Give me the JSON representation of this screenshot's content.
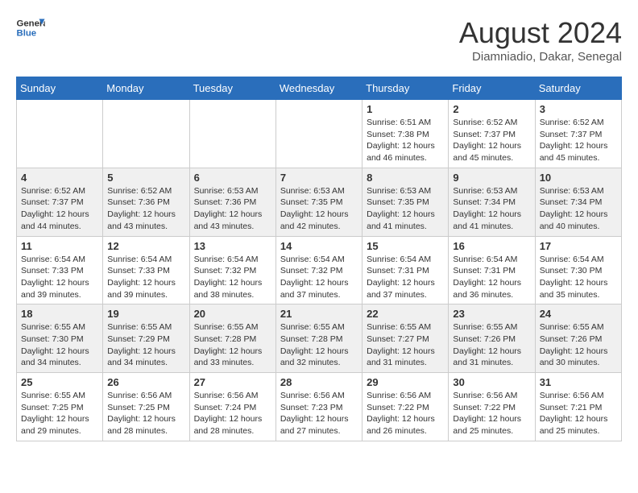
{
  "header": {
    "logo_line1": "General",
    "logo_line2": "Blue",
    "month_year": "August 2024",
    "location": "Diamniadio, Dakar, Senegal"
  },
  "days_of_week": [
    "Sunday",
    "Monday",
    "Tuesday",
    "Wednesday",
    "Thursday",
    "Friday",
    "Saturday"
  ],
  "weeks": [
    [
      {
        "day": "",
        "info": ""
      },
      {
        "day": "",
        "info": ""
      },
      {
        "day": "",
        "info": ""
      },
      {
        "day": "",
        "info": ""
      },
      {
        "day": "1",
        "info": "Sunrise: 6:51 AM\nSunset: 7:38 PM\nDaylight: 12 hours\nand 46 minutes."
      },
      {
        "day": "2",
        "info": "Sunrise: 6:52 AM\nSunset: 7:37 PM\nDaylight: 12 hours\nand 45 minutes."
      },
      {
        "day": "3",
        "info": "Sunrise: 6:52 AM\nSunset: 7:37 PM\nDaylight: 12 hours\nand 45 minutes."
      }
    ],
    [
      {
        "day": "4",
        "info": "Sunrise: 6:52 AM\nSunset: 7:37 PM\nDaylight: 12 hours\nand 44 minutes."
      },
      {
        "day": "5",
        "info": "Sunrise: 6:52 AM\nSunset: 7:36 PM\nDaylight: 12 hours\nand 43 minutes."
      },
      {
        "day": "6",
        "info": "Sunrise: 6:53 AM\nSunset: 7:36 PM\nDaylight: 12 hours\nand 43 minutes."
      },
      {
        "day": "7",
        "info": "Sunrise: 6:53 AM\nSunset: 7:35 PM\nDaylight: 12 hours\nand 42 minutes."
      },
      {
        "day": "8",
        "info": "Sunrise: 6:53 AM\nSunset: 7:35 PM\nDaylight: 12 hours\nand 41 minutes."
      },
      {
        "day": "9",
        "info": "Sunrise: 6:53 AM\nSunset: 7:34 PM\nDaylight: 12 hours\nand 41 minutes."
      },
      {
        "day": "10",
        "info": "Sunrise: 6:53 AM\nSunset: 7:34 PM\nDaylight: 12 hours\nand 40 minutes."
      }
    ],
    [
      {
        "day": "11",
        "info": "Sunrise: 6:54 AM\nSunset: 7:33 PM\nDaylight: 12 hours\nand 39 minutes."
      },
      {
        "day": "12",
        "info": "Sunrise: 6:54 AM\nSunset: 7:33 PM\nDaylight: 12 hours\nand 39 minutes."
      },
      {
        "day": "13",
        "info": "Sunrise: 6:54 AM\nSunset: 7:32 PM\nDaylight: 12 hours\nand 38 minutes."
      },
      {
        "day": "14",
        "info": "Sunrise: 6:54 AM\nSunset: 7:32 PM\nDaylight: 12 hours\nand 37 minutes."
      },
      {
        "day": "15",
        "info": "Sunrise: 6:54 AM\nSunset: 7:31 PM\nDaylight: 12 hours\nand 37 minutes."
      },
      {
        "day": "16",
        "info": "Sunrise: 6:54 AM\nSunset: 7:31 PM\nDaylight: 12 hours\nand 36 minutes."
      },
      {
        "day": "17",
        "info": "Sunrise: 6:54 AM\nSunset: 7:30 PM\nDaylight: 12 hours\nand 35 minutes."
      }
    ],
    [
      {
        "day": "18",
        "info": "Sunrise: 6:55 AM\nSunset: 7:30 PM\nDaylight: 12 hours\nand 34 minutes."
      },
      {
        "day": "19",
        "info": "Sunrise: 6:55 AM\nSunset: 7:29 PM\nDaylight: 12 hours\nand 34 minutes."
      },
      {
        "day": "20",
        "info": "Sunrise: 6:55 AM\nSunset: 7:28 PM\nDaylight: 12 hours\nand 33 minutes."
      },
      {
        "day": "21",
        "info": "Sunrise: 6:55 AM\nSunset: 7:28 PM\nDaylight: 12 hours\nand 32 minutes."
      },
      {
        "day": "22",
        "info": "Sunrise: 6:55 AM\nSunset: 7:27 PM\nDaylight: 12 hours\nand 31 minutes."
      },
      {
        "day": "23",
        "info": "Sunrise: 6:55 AM\nSunset: 7:26 PM\nDaylight: 12 hours\nand 31 minutes."
      },
      {
        "day": "24",
        "info": "Sunrise: 6:55 AM\nSunset: 7:26 PM\nDaylight: 12 hours\nand 30 minutes."
      }
    ],
    [
      {
        "day": "25",
        "info": "Sunrise: 6:55 AM\nSunset: 7:25 PM\nDaylight: 12 hours\nand 29 minutes."
      },
      {
        "day": "26",
        "info": "Sunrise: 6:56 AM\nSunset: 7:25 PM\nDaylight: 12 hours\nand 28 minutes."
      },
      {
        "day": "27",
        "info": "Sunrise: 6:56 AM\nSunset: 7:24 PM\nDaylight: 12 hours\nand 28 minutes."
      },
      {
        "day": "28",
        "info": "Sunrise: 6:56 AM\nSunset: 7:23 PM\nDaylight: 12 hours\nand 27 minutes."
      },
      {
        "day": "29",
        "info": "Sunrise: 6:56 AM\nSunset: 7:22 PM\nDaylight: 12 hours\nand 26 minutes."
      },
      {
        "day": "30",
        "info": "Sunrise: 6:56 AM\nSunset: 7:22 PM\nDaylight: 12 hours\nand 25 minutes."
      },
      {
        "day": "31",
        "info": "Sunrise: 6:56 AM\nSunset: 7:21 PM\nDaylight: 12 hours\nand 25 minutes."
      }
    ]
  ]
}
